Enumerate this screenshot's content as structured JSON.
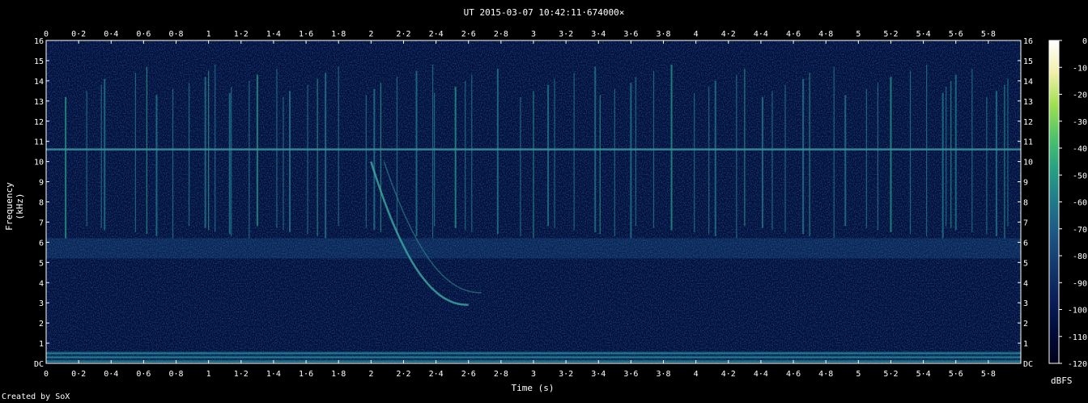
{
  "title": "UT 2015-03-07 10:42:11·674000×",
  "footer": "Created by SoX",
  "colors": {
    "background": "#000000",
    "text": "#ffffff",
    "colormap": [
      "#00001a",
      "#000b3a",
      "#0a1e5a",
      "#13386e",
      "#1c5684",
      "#1f7a8a",
      "#25a083",
      "#4cc46a",
      "#9ee04e",
      "#f2f0a8",
      "#ffffff"
    ]
  },
  "chart_data": {
    "type": "heatmap",
    "title": "UT 2015-03-07 10:42:11·674000×",
    "xlabel": "Time (s)",
    "ylabel": "Frequency (kHz)",
    "xlim": [
      0,
      6
    ],
    "ylim": [
      0,
      16
    ],
    "x_ticks": [
      "0",
      "0·2",
      "0·4",
      "0·6",
      "0·8",
      "1",
      "1·2",
      "1·4",
      "1·6",
      "1·8",
      "2",
      "2·2",
      "2·4",
      "2·6",
      "2·8",
      "3",
      "3·2",
      "3·4",
      "3·6",
      "3·8",
      "4",
      "4·2",
      "4·4",
      "4·6",
      "4·8",
      "5",
      "5·2",
      "5·4",
      "5·6",
      "5·8"
    ],
    "y_ticks": [
      "DC",
      "1",
      "2",
      "3",
      "4",
      "5",
      "6",
      "7",
      "8",
      "9",
      "10",
      "11",
      "12",
      "13",
      "14",
      "15",
      "16"
    ],
    "colorbar": {
      "label": "dBFS",
      "ticks": [
        "0",
        "-10",
        "-20",
        "-30",
        "-40",
        "-50",
        "-60",
        "-70",
        "-80",
        "-90",
        "-100",
        "-110",
        "-120"
      ]
    },
    "features": {
      "tone_khz": [
        10.6,
        0.1,
        0.3,
        0.5
      ],
      "broadband_bands_khz": [
        [
          0,
          0.6
        ],
        [
          5.2,
          6.2
        ]
      ],
      "whistler_sweep": {
        "t_start_s": 2.0,
        "f_start_khz": 10.0,
        "t_end_s": 2.6,
        "f_end_khz": 2.9
      },
      "impulse_times_s": [
        0.12,
        0.25,
        0.34,
        0.36,
        0.55,
        0.62,
        0.68,
        0.78,
        0.88,
        0.98,
        1.0,
        1.04,
        1.13,
        1.14,
        1.25,
        1.3,
        1.42,
        1.46,
        1.5,
        1.61,
        1.67,
        1.72,
        1.8,
        1.97,
        2.02,
        2.06,
        2.16,
        2.28,
        2.38,
        2.39,
        2.52,
        2.58,
        2.62,
        2.78,
        2.92,
        3.0,
        3.09,
        3.13,
        3.25,
        3.38,
        3.41,
        3.5,
        3.6,
        3.63,
        3.74,
        3.85,
        3.99,
        4.08,
        4.12,
        4.25,
        4.3,
        4.41,
        4.47,
        4.55,
        4.66,
        4.7,
        4.85,
        4.92,
        5.05,
        5.12,
        5.2,
        5.32,
        5.42,
        5.52,
        5.54,
        5.57,
        5.6,
        5.7,
        5.79,
        5.85,
        5.9,
        5.92
      ]
    }
  }
}
